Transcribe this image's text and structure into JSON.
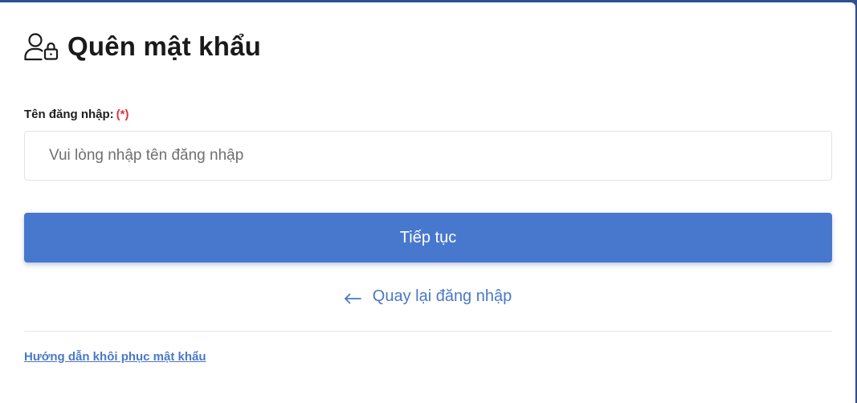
{
  "header": {
    "icon": "user-lock-icon",
    "title": "Quên mật khẩu"
  },
  "form": {
    "username_label": "Tên đăng nhập:",
    "required_marker": "(*)",
    "username_value": "",
    "username_placeholder": "Vui lòng nhập tên đăng nhập",
    "submit_label": "Tiếp tục"
  },
  "back": {
    "icon": "arrow-left-icon",
    "label": "Quay lại đăng nhập"
  },
  "footer": {
    "help_link": "Hướng dẫn khôi phục mật khẩu"
  },
  "colors": {
    "primary": "#4878cd",
    "link": "#4a78c8",
    "required": "#d9363e",
    "top_border": "#2f4e93"
  }
}
